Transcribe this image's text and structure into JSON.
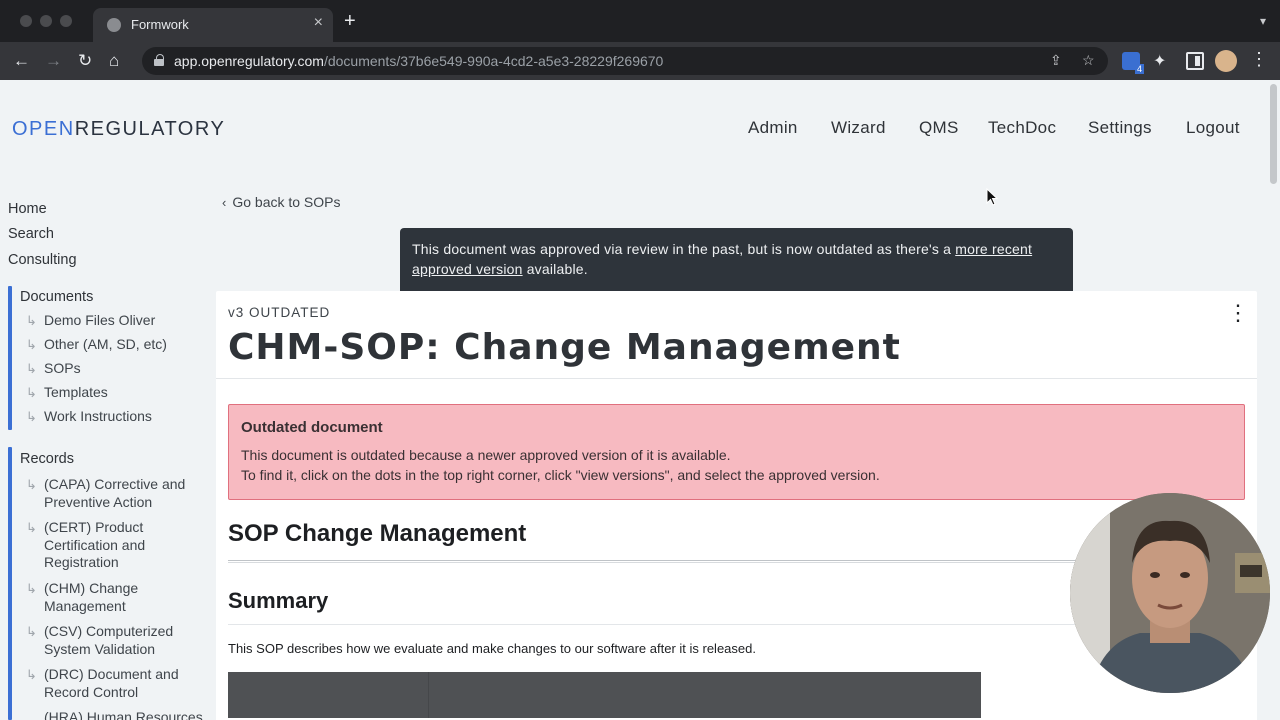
{
  "browser": {
    "tab_title": "Formwork",
    "tab_close": "×",
    "new_tab": "+",
    "url_host": "app.openregulatory.com",
    "url_path": "/documents/37b6e549-990a-4cd2-a5e3-28229f269670",
    "extension_badge": "4"
  },
  "header": {
    "logo_part1": "OPEN",
    "logo_part2": "REGULATORY",
    "nav": [
      "Admin",
      "Wizard",
      "QMS",
      "TechDoc",
      "Settings",
      "Logout"
    ]
  },
  "sidebar": {
    "top_links": [
      "Home",
      "Search",
      "Consulting"
    ],
    "documents": {
      "title": "Documents",
      "items": [
        "Demo Files Oliver",
        "Other (AM, SD, etc)",
        "SOPs",
        "Templates",
        "Work Instructions"
      ]
    },
    "records": {
      "title": "Records",
      "items": [
        "(CAPA) Corrective and Preventive Action",
        "(CERT) Product Certification and Registration",
        "(CHM) Change Management",
        "(CSV) Computerized System Validation",
        "(DRC) Document and Record Control",
        "(HRA) Human Resources"
      ]
    }
  },
  "main": {
    "back_link": "Go back to SOPs",
    "banner": {
      "text_before": "This document was approved via review in the past, but is now outdated as there's a ",
      "link_text": "more recent approved version",
      "text_after": " available."
    },
    "version_label": "v3 OUTDATED",
    "title": "CHM-SOP: Change Management",
    "alert": {
      "title": "Outdated document",
      "line1": "This document is outdated because a newer approved version of it is available.",
      "line2": "To find it, click on the dots in the top right corner, click \"view versions\", and select the approved version."
    },
    "h1": "SOP Change Management",
    "h2": "Summary",
    "paragraph": "This SOP describes how we evaluate and make changes to our software after it is released."
  },
  "colors": {
    "accent": "#3b6fd4",
    "banner_bg": "#2e343b",
    "alert_bg": "#f7bac1",
    "alert_border": "#e0707e"
  }
}
